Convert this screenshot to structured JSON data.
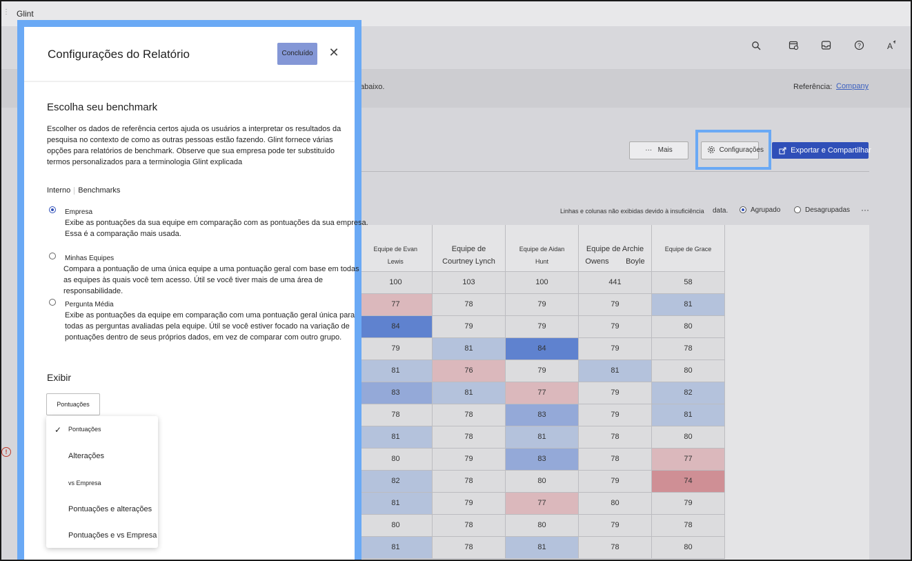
{
  "app": {
    "title": "Glint"
  },
  "toolbar": {
    "icons": [
      "search-icon",
      "calendar-settings-icon",
      "inbox-icon",
      "help-icon",
      "text-settings-icon"
    ]
  },
  "reference_bar": {
    "prefix_text": "abaixo.",
    "label": "Referência:",
    "link": "Company"
  },
  "actions": {
    "more_label": "Mais",
    "settings_label": "Configurações",
    "export_label": "Exportar e Compartilhar"
  },
  "filters": {
    "info_text": "Linhas e colunas não exibidas devido à insuficiência",
    "info_text_end": "data.",
    "grouped_label": "Agrupado",
    "ungrouped_label": "Desagrupadas",
    "grouped_selected": true
  },
  "heatmap": {
    "headers": [
      {
        "line1": "Equipe de Evan",
        "line2": "Lewis"
      },
      {
        "line1": "Equipe de",
        "line2": "Courtney Lynch"
      },
      {
        "line1": "Equipe de Aidan",
        "line2": "Hunt"
      },
      {
        "line1": "Equipe de Archie",
        "line2": "Owens        Boyle"
      },
      {
        "line1": "Equipe de Grace",
        "line2": ""
      }
    ],
    "rows": [
      [
        100,
        103,
        100,
        441,
        58
      ],
      [
        77,
        78,
        79,
        79,
        81
      ],
      [
        84,
        79,
        79,
        79,
        80
      ],
      [
        79,
        81,
        84,
        79,
        78
      ],
      [
        81,
        76,
        79,
        81,
        80
      ],
      [
        83,
        81,
        77,
        79,
        82
      ],
      [
        78,
        78,
        83,
        79,
        81
      ],
      [
        81,
        78,
        81,
        78,
        80
      ],
      [
        80,
        79,
        83,
        78,
        77
      ],
      [
        82,
        78,
        80,
        79,
        74
      ],
      [
        81,
        79,
        77,
        80,
        79
      ],
      [
        80,
        78,
        80,
        79,
        78
      ],
      [
        81,
        78,
        81,
        78,
        80
      ]
    ],
    "colors": {
      "neutral": "#dcdcde",
      "blue_light": "#b4c2dc",
      "blue_mid": "#94a9d8",
      "blue_strong": "#5f82cf",
      "red_light": "#dbb8bc",
      "red_mid": "#cf8f95"
    }
  },
  "panel": {
    "title": "Configurações do Relatório",
    "done_label": "Concluído",
    "benchmark_heading": "Escolha seu benchmark",
    "benchmark_desc": "Escolher os dados de referência certos ajuda os usuários a interpretar os resultados da pesquisa no contexto de como as outras pessoas estão fazendo. Glint fornece várias opções para relatórios de benchmark. Observe que sua empresa pode ter substituído termos personalizados para a terminologia Glint explicada",
    "tab_internal": "Interno",
    "tab_benchmarks": "Benchmarks",
    "options": [
      {
        "title": "Empresa",
        "desc": "Exibe as pontuações da sua equipe em comparação com as pontuações da sua empresa. Essa é a comparação mais usada.",
        "selected": true
      },
      {
        "title": "Minhas Equipes",
        "desc": "Compara a pontuação de uma única equipe a uma pontuação geral com base em todas as equipes às quais você tem acesso. Útil se você tiver mais de uma área de responsabilidade.",
        "selected": false
      },
      {
        "title": "Pergunta Média",
        "desc": "Exibe as pontuações da equipe em comparação com uma pontuação geral única para todas as perguntas avaliadas pela equipe. Útil se você estiver focado na variação de pontuações dentro de seus próprios dados, em vez de comparar com outro grupo.",
        "selected": false
      }
    ],
    "display_heading": "Exibir",
    "display_value": "Pontuações",
    "display_menu": [
      "Pontuações",
      "Alterações",
      "vs Empresa",
      "Pontuações e alterações",
      "Pontuações e vs Empresa"
    ]
  }
}
